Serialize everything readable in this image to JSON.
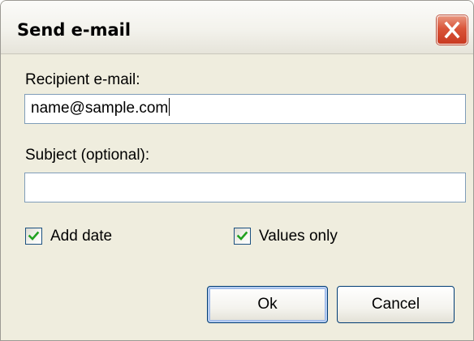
{
  "dialog": {
    "title": "Send e-mail",
    "close_icon": "close-icon"
  },
  "recipient": {
    "label": "Recipient e-mail:",
    "value": "name@sample.com"
  },
  "subject": {
    "label": "Subject (optional):",
    "value": ""
  },
  "options": {
    "add_date": {
      "label": "Add date",
      "checked": true
    },
    "values_only": {
      "label": "Values only",
      "checked": true
    }
  },
  "buttons": {
    "ok": "Ok",
    "cancel": "Cancel"
  },
  "colors": {
    "window_bg": "#efedde",
    "close_red": "#d9553a",
    "textbox_border": "#7f9db9",
    "checkbox_border": "#1c5180",
    "check_green": "#21a121",
    "button_border": "#003c74"
  }
}
